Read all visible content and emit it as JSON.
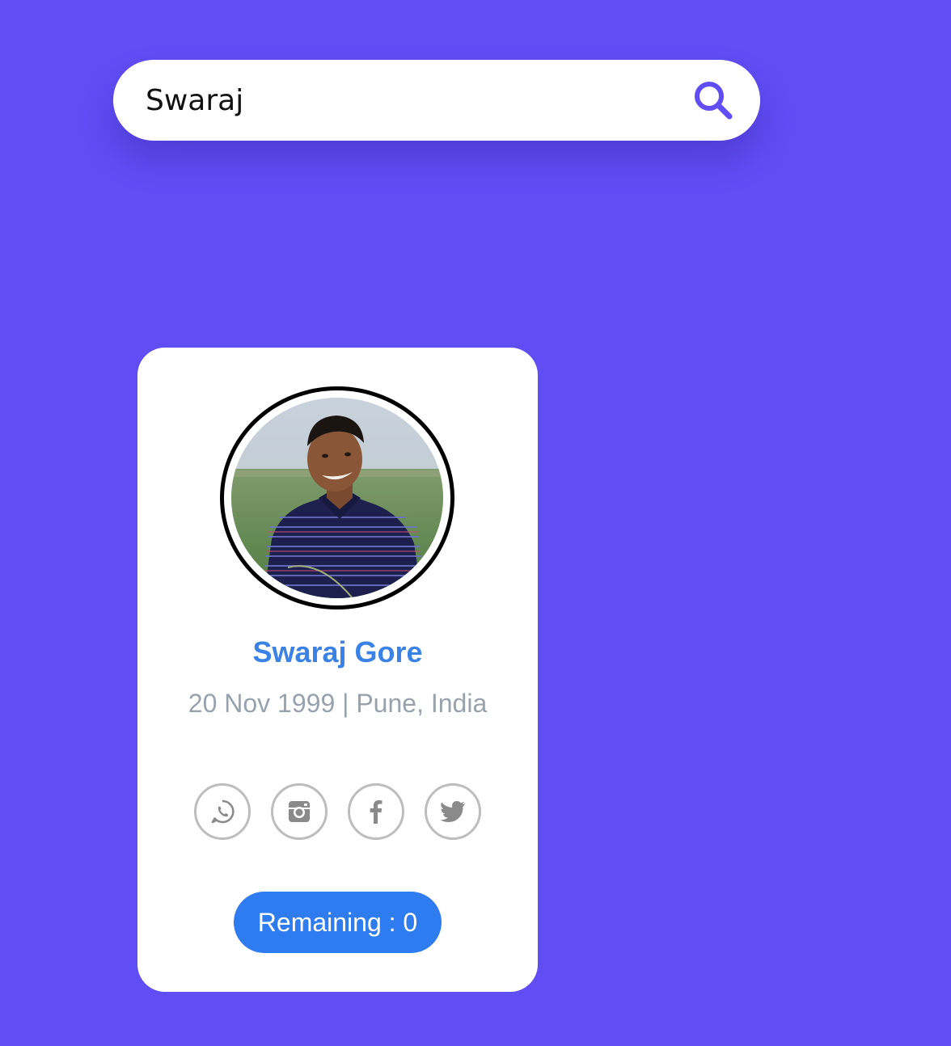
{
  "search": {
    "value": "Swaraj",
    "placeholder": "",
    "icon": "search-icon"
  },
  "profile": {
    "name": "Swaraj Gore",
    "meta": "20 Nov 1999 | Pune, India",
    "avatar_alt": "profile photo",
    "socials": [
      {
        "icon": "whatsapp-icon"
      },
      {
        "icon": "instagram-icon"
      },
      {
        "icon": "facebook-icon"
      },
      {
        "icon": "twitter-icon"
      }
    ],
    "remaining_label": "Remaining : 0"
  },
  "colors": {
    "background": "#604df4",
    "accent": "#3b82e6",
    "search_icon": "#604df4",
    "badge": "#2f7cf0",
    "muted_text": "#98a2ad",
    "social_border": "#bdbdbd"
  }
}
